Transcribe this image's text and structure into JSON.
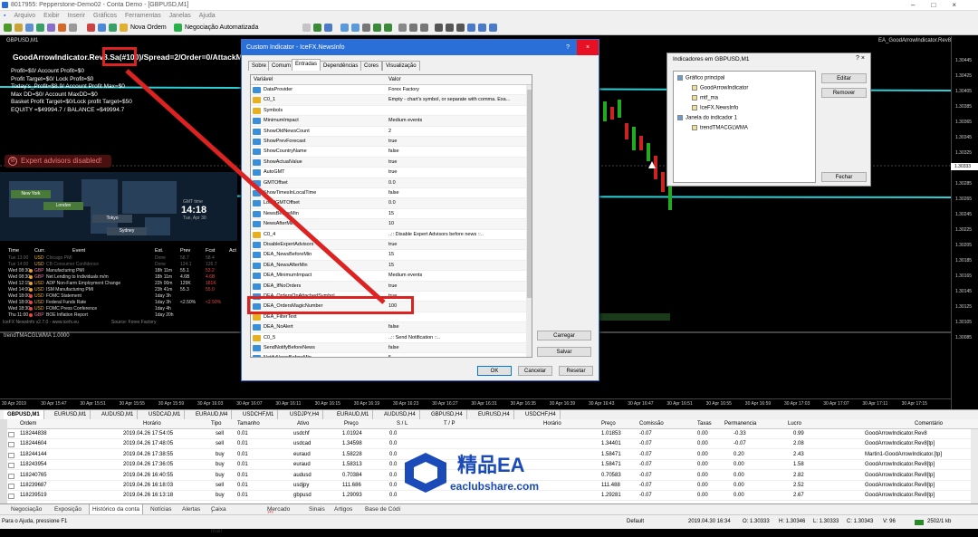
{
  "window": {
    "title": "8017955: Pepperstone-Demo02 - Conta Demo - [GBPUSD,M1]"
  },
  "menu": [
    "Arquivo",
    "Exibir",
    "Inserir",
    "Gráficos",
    "Ferramentas",
    "Janelas",
    "Ajuda"
  ],
  "toolbar": {
    "new_order": "Nova Ordem",
    "auto_trading": "Negociação Automatizada"
  },
  "chart": {
    "symbol_label": "GBPUSD,M1",
    "ea_label": "EA_GoodArrowIndicator.Rev8",
    "hud_line1_a": "GoodArrowIndicator.Rev8.Sa",
    "hud_line1_b": "(#100)",
    "hud_line1_c": "/Spread=2/Order=0/AttackMart",
    "hud": [
      "Profit=$0/ Account Profit=$0",
      "Profit Target=$0/ Lock Profit=$0",
      "Today's_Profit=$8.9/ Account Profit Max=$0",
      "Max DD=$0/ Account MaxDD=$0",
      "Basket Profit Target=$0/Lock profit Target=$50",
      "EQUITY =$49994.7 / BALANCE =$49994.7"
    ],
    "ea_warning": "Expert advisors disabled!",
    "gmt_label": "GMT time",
    "gmt_time": "14:18",
    "gmt_date": "Tue, Apr 30",
    "timezones": [
      "New York",
      "London",
      "Tokyo",
      "Sydney"
    ],
    "indicator_name": "trendTMACGLWMA 1.0000",
    "prices": [
      "1.30445",
      "1.30425",
      "1.30405",
      "1.30385",
      "1.30365",
      "1.30345",
      "1.30325",
      "1.30305",
      "1.30285",
      "1.30265",
      "1.30245",
      "1.30225",
      "1.30205",
      "1.30185",
      "1.30165",
      "1.30145",
      "1.30125",
      "1.30105",
      "1.30085"
    ],
    "bid_price": "1.30333",
    "x_labels": [
      "30 Apr 2019",
      "30 Apr 15:47",
      "30 Apr 15:51",
      "30 Apr 15:55",
      "30 Apr 15:59",
      "30 Apr 16:03",
      "30 Apr 16:07",
      "30 Apr 16:11",
      "30 Apr 16:15",
      "30 Apr 16:19",
      "30 Apr 16:23",
      "30 Apr 16:27",
      "30 Apr 16:31",
      "30 Apr 16:35",
      "30 Apr 16:39",
      "30 Apr 16:43",
      "30 Apr 16:47",
      "30 Apr 16:51",
      "30 Apr 16:55",
      "30 Apr 16:59",
      "30 Apr 17:03",
      "30 Apr 17:07",
      "30 Apr 17:11",
      "30 Apr 17:15"
    ]
  },
  "news": {
    "headers": [
      "Time",
      "Curr.",
      "Event",
      "Est.",
      "Prev",
      "Fcst",
      "Act"
    ],
    "rows": [
      [
        "Tue 13:00",
        "USD",
        "Chicago PMI",
        "Done",
        "58.7",
        "58.4",
        ""
      ],
      [
        "Tue 14:00",
        "USD",
        "CB Consumer Confidence",
        "Done",
        "124.1",
        "126.7",
        ""
      ],
      [
        "Wed 08:30",
        "GBP",
        "Manufacturing PMI",
        "18h 11m",
        "55.1",
        "53.2",
        ""
      ],
      [
        "Wed 08:30",
        "GBP",
        "Net Lending to Individuals m/m",
        "18h 11m",
        "4.6B",
        "4.6B",
        ""
      ],
      [
        "Wed 12:15",
        "USD",
        "ADP Non-Farm Employment Change",
        "22h 00m",
        "129K",
        "181K",
        ""
      ],
      [
        "Wed 14:00",
        "USD",
        "ISM Manufacturing PMI",
        "23h 41m",
        "55.3",
        "55.0",
        ""
      ],
      [
        "Wed 18:00",
        "USD",
        "FOMC Statement",
        "1day 3h",
        "",
        "",
        " "
      ],
      [
        "Wed 18:00",
        "USD",
        "Federal Funds Rate",
        "1day 3h",
        "<2.50%",
        "<2.50%",
        ""
      ],
      [
        "Wed 18:30",
        "USD",
        "FOMC Press Conference",
        "1day 4h",
        "",
        "",
        " "
      ],
      [
        "Thu 11:00",
        "GBP",
        "BOE Inflation Report",
        "1day 20h",
        "",
        "",
        " "
      ]
    ],
    "footer": "IceFX NewsInfo v2.7.0 - www.icefx.eu",
    "source": "Source: Forex Factory"
  },
  "dialog": {
    "title": "Custom Indicator - IceFX.NewsInfo",
    "help": "?",
    "tabs": [
      "Sobre",
      "Comum",
      "Entradas",
      "Dependências",
      "Cores",
      "Visualização"
    ],
    "active_tab": 2,
    "col_variable": "Variável",
    "col_value": "Valor",
    "params": [
      {
        "n": "DataProvider",
        "v": "Forex Factory",
        "t": "n"
      },
      {
        "n": "C0_1",
        "v": "Empty - chart's symbol, or separate with comma. Exa...",
        "t": "a"
      },
      {
        "n": "Symbols",
        "v": "",
        "t": "a"
      },
      {
        "n": "MinimumImpact",
        "v": "Medium events",
        "t": "n"
      },
      {
        "n": "ShowOldNewsCount",
        "v": "2",
        "t": "n"
      },
      {
        "n": "ShowPrevForecast",
        "v": "true",
        "t": "n"
      },
      {
        "n": "ShowCountryName",
        "v": "false",
        "t": "n"
      },
      {
        "n": "ShowActualValue",
        "v": "true",
        "t": "n"
      },
      {
        "n": "AutoGMT",
        "v": "true",
        "t": "n"
      },
      {
        "n": "GMTOffset",
        "v": "0.0",
        "t": "n"
      },
      {
        "n": "ShowTimesInLocalTime",
        "v": "false",
        "t": "n"
      },
      {
        "n": "LocalGMTOffset",
        "v": "0.0",
        "t": "n"
      },
      {
        "n": "NewsBeforeMin",
        "v": "15",
        "t": "n"
      },
      {
        "n": "NewsAfterMin",
        "v": "10",
        "t": "n"
      },
      {
        "n": "C0_4",
        "v": "..:: Disable Expert Advisors before news ::..",
        "t": "a"
      },
      {
        "n": "DisableExpertAdvisors",
        "v": "true",
        "t": "n"
      },
      {
        "n": "DEA_NewsBeforeMin",
        "v": "15",
        "t": "n"
      },
      {
        "n": "DEA_NewsAfterMin",
        "v": "15",
        "t": "n"
      },
      {
        "n": "DEA_MinimumImpact",
        "v": "Medium events",
        "t": "n"
      },
      {
        "n": "DEA_IfNoOrders",
        "v": "true",
        "t": "n"
      },
      {
        "n": "DEA_OrdersOnAttachedSymbol",
        "v": "true",
        "t": "n"
      },
      {
        "n": "DEA_OrdersMagicNumber",
        "v": "100",
        "t": "n"
      },
      {
        "n": "DEA_FilterText",
        "v": "",
        "t": "a"
      },
      {
        "n": "DEA_NoAlert",
        "v": "false",
        "t": "n"
      },
      {
        "n": "C0_5",
        "v": "..:: Send Notification ::..",
        "t": "a"
      },
      {
        "n": "SendNotifyBeforeNews",
        "v": "false",
        "t": "n"
      },
      {
        "n": "NotifyNewsBeforeMin",
        "v": "5",
        "t": "n"
      }
    ],
    "btn_load": "Carregar",
    "btn_save": "Salvar",
    "btn_ok": "OK",
    "btn_cancel": "Cancelar",
    "btn_reset": "Resetar"
  },
  "indicators_panel": {
    "title": "Indicadores em GBPUSD,M1",
    "help": "?",
    "close": "×",
    "tree": [
      "Gráfico principal",
      "GoodArrowIndicator",
      "mtf_ma",
      "IceFX.NewsInfo",
      "Janela do indicador 1",
      "trendTMACGLWMA"
    ],
    "btn_edit": "Editar",
    "btn_remove": "Remover",
    "btn_close": "Fechar"
  },
  "symbol_tabs": [
    "GBPUSD,M1",
    "EURUSD,M1",
    "AUDUSD,M1",
    "USDCAD,M1",
    "EURAUD,M4",
    "USDCHF,M1",
    "USDJPY,H4",
    "EURAUD,M1",
    "AUDUSD,H4",
    "GBPUSD,H4",
    "EURUSD,H4",
    "USDCHF,H4"
  ],
  "terminal": {
    "headers": [
      "Ordem",
      "Horário",
      "Tipo",
      "Tamanho",
      "Ativo",
      "Preço",
      "S / L",
      "T / P",
      "Horário",
      "Preço",
      "Comissão",
      "Taxas",
      "Permanencia",
      "Lucro",
      "Comentário"
    ],
    "rows": [
      [
        "118244838",
        "2019.04.26 17:54:05",
        "sell",
        "0.01",
        "usdchf",
        "1.01924",
        "0.0",
        "",
        "",
        "1.01853",
        "-0.07",
        "0.00",
        "-0.33",
        "0.99",
        "GoodArrowIndicator.Rev8"
      ],
      [
        "118244604",
        "2019.04.26 17:48:05",
        "sell",
        "0.01",
        "usdcad",
        "1.34598",
        "0.0",
        "",
        "",
        "1.34401",
        "-0.07",
        "0.00",
        "-0.07",
        "2.08",
        "GoodArrowIndicator.Rev8[tp]"
      ],
      [
        "118244144",
        "2019.04.26 17:38:55",
        "buy",
        "0.01",
        "euraud",
        "1.58228",
        "0.0",
        "",
        "",
        "1.58471",
        "-0.07",
        "0.00",
        "0.20",
        "2.43",
        "Martin1-GoodArrowIndicator.[tp]"
      ],
      [
        "118243954",
        "2019.04.26 17:36:05",
        "buy",
        "0.01",
        "euraud",
        "1.58313",
        "0.0",
        "",
        "",
        "1.58471",
        "-0.07",
        "0.00",
        "0.00",
        "1.58",
        "GoodArrowIndicator.Rev8[tp]"
      ],
      [
        "118240765",
        "2019.04.26 16:40:55",
        "buy",
        "0.01",
        "audusd",
        "0.70384",
        "0.0",
        "",
        "",
        "0.70583",
        "-0.07",
        "0.00",
        "0.00",
        "2.82",
        "GoodArrowIndicator.Rev8[tp]"
      ],
      [
        "118239687",
        "2019.04.26 16:18:03",
        "sell",
        "0.01",
        "usdjpy",
        "111.686",
        "0.0",
        "",
        "",
        "111.488",
        "-0.07",
        "0.00",
        "0.00",
        "2.52",
        "GoodArrowIndicator.Rev8[tp]"
      ],
      [
        "118239519",
        "2019.04.26 16:13:18",
        "buy",
        "0.01",
        "gbpusd",
        "1.29093",
        "0.0",
        "",
        "",
        "1.29281",
        "-0.07",
        "0.00",
        "0.00",
        "2.67",
        "GoodArrowIndicator.Rev8[tp]"
      ]
    ]
  },
  "bottom_tabs": [
    "Negociação",
    "Exposição",
    "Histórico da conta",
    "Notícias",
    "Alertas",
    "Caixa de E-mail",
    "Mercado",
    "Sinais",
    "Artigos",
    "Base de Códi"
  ],
  "bottom_badges": {
    "email": "7",
    "market": "149"
  },
  "status": {
    "help": "Para o Ajuda, pressione F1",
    "profile": "Default",
    "datetime": "2019.04.30 16:34",
    "open": "O: 1.30333",
    "high": "H: 1.30346",
    "low": "L: 1.30333",
    "close": "C: 1.30343",
    "volume": "V: 96",
    "traffic": "2502/1 kb"
  },
  "watermark": {
    "brand": "精品EA",
    "site": "eaclubshare.com"
  },
  "colors": {
    "dialog_title": "#2a6fd8",
    "highlight": "#d22222",
    "chart_bg": "#000000",
    "hud_cyan": "#40e0e0"
  }
}
